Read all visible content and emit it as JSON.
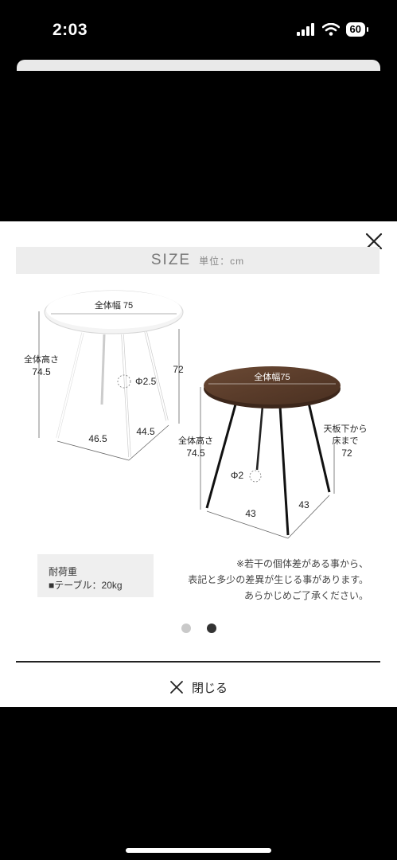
{
  "status_bar": {
    "time": "2:03",
    "battery": "60"
  },
  "modal": {
    "size_title": "SIZE",
    "size_unit": "単位：cm",
    "diagram": {
      "white_table": {
        "width_label": "全体幅 75",
        "height_label_1": "全体高さ",
        "height_value": "74.5",
        "leg_height": "72",
        "leg_diameter": "Φ2.5",
        "leg_span_a": "46.5",
        "leg_span_b": "44.5"
      },
      "brown_table": {
        "width_label": "全体幅75",
        "height_label_1": "全体高さ",
        "height_value": "74.5",
        "leg_diameter": "Φ2",
        "top_to_floor_1": "天板下から",
        "top_to_floor_2": "床まで",
        "top_to_floor_value": "72",
        "leg_span_a": "43",
        "leg_span_b": "43"
      }
    },
    "load": {
      "title": "耐荷重",
      "value": "■テーブル：20kg"
    },
    "note": {
      "line1": "※若干の個体差がある事から、",
      "line2": "表記と多少の差異が生じる事があります。",
      "line3": "あらかじめご了承ください。"
    },
    "close_label": "閉じる"
  },
  "pager": {
    "count": 2,
    "active_index": 2
  }
}
